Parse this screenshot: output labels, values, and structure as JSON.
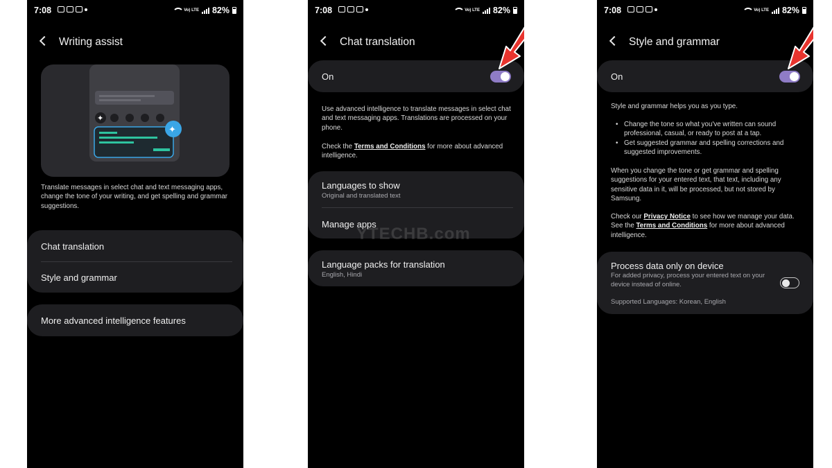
{
  "status": {
    "time": "7:08",
    "battery": "82%",
    "volte": "Vo) LTE"
  },
  "screen1": {
    "title": "Writing assist",
    "description": "Translate messages in select chat and text messaging apps, change the tone of your writing, and get spelling and grammar suggestions.",
    "items": [
      {
        "label": "Chat translation"
      },
      {
        "label": "Style and grammar"
      }
    ],
    "more": "More advanced intelligence features",
    "watermark": "YTECHB.com"
  },
  "screen2": {
    "title": "Chat translation",
    "toggle_label": "On",
    "toggle_state": true,
    "desc": "Use advanced intelligence to translate messages in select chat and text messaging apps. Translations are processed on your phone.",
    "check_pre": "Check the ",
    "terms_link": "Terms and Conditions",
    "check_post": " for more about advanced intelligence.",
    "languages_label": "Languages to show",
    "languages_sub": "Original and translated text",
    "manage_apps": "Manage apps",
    "packs_label": "Language packs for translation",
    "packs_sub": "English, Hindi",
    "watermark": "YTECHB.com"
  },
  "screen3": {
    "title": "Style and grammar",
    "toggle_label": "On",
    "toggle_state": true,
    "intro": "Style and grammar helps you as you type.",
    "bullets": [
      "Change the tone so what you've written can sound professional, casual, or ready to post at a tap.",
      "Get suggested grammar and spelling corrections and suggested improvements."
    ],
    "processing": "When you change the tone or get grammar and spelling suggestions for your entered text, that text, including any sensitive data in it, will be processed, but not stored by Samsung.",
    "check_pre": "Check our ",
    "privacy_link": "Privacy Notice",
    "check_mid": " to see how we manage your data. See the ",
    "terms_link": "Terms and Conditions",
    "check_post": " for more about advanced intelligence.",
    "device_label": "Process data only on device",
    "device_sub": "For added privacy, process your entered text on your device instead of online.",
    "device_toggle_state": false,
    "languages": "Supported Languages: Korean, English"
  },
  "colors": {
    "toggle_on": "#8f7cc6",
    "card": "#1e1e21",
    "arrow": "#e8342e",
    "accent_teal": "#2ec4a0",
    "sparkle": "#3aa6e6"
  }
}
